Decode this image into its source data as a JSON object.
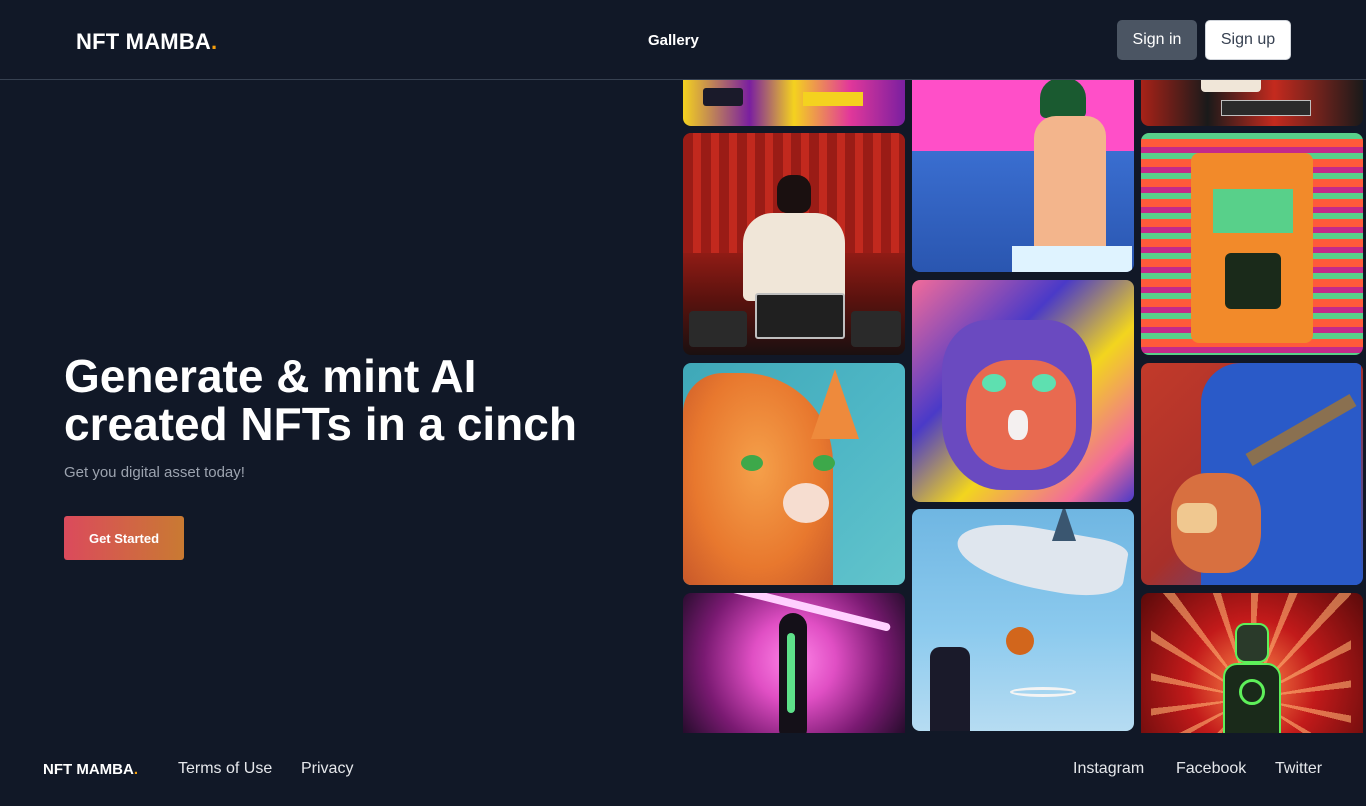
{
  "header": {
    "logo_text": "NFT MAMBA",
    "logo_dot": ".",
    "nav_gallery": "Gallery",
    "signin_label": "Sign in",
    "signup_label": "Sign up"
  },
  "hero": {
    "title": "Generate & mint AI created NFTs in a cinch",
    "subtitle": "Get you digital asset today!",
    "cta_label": "Get Started"
  },
  "gallery": {
    "tiles": [
      {
        "subject": "dj-turntables",
        "colors": [
          "#f4d21f",
          "#7a1fa0",
          "#e2389a"
        ]
      },
      {
        "subject": "dj-white-suit",
        "colors": [
          "#8c1a14",
          "#f0e6d8",
          "#1a1a1a"
        ]
      },
      {
        "subject": "orange-cat",
        "colors": [
          "#f08a3c",
          "#4fb7c6",
          "#f4c9a2"
        ]
      },
      {
        "subject": "neon-robot-woman",
        "colors": [
          "#e04fc4",
          "#1a0a22",
          "#5ee08a"
        ]
      },
      {
        "subject": "pixel-boy-sea",
        "colors": [
          "#ff4fc8",
          "#3466c8",
          "#f3b58c"
        ]
      },
      {
        "subject": "pixel-cat",
        "colors": [
          "#f26b9a",
          "#4a3ac8",
          "#f2d51e"
        ]
      },
      {
        "subject": "shark-basketball",
        "colors": [
          "#7fbfe6",
          "#dfe6ee",
          "#d2661c"
        ]
      },
      {
        "subject": "dj-turntables-2",
        "colors": [
          "#c42a1e",
          "#f0e6d8",
          "#1a1a1a"
        ]
      },
      {
        "subject": "pixel-robot-face",
        "colors": [
          "#ff5a3a",
          "#58d08a",
          "#c42a8a"
        ]
      },
      {
        "subject": "guitarist",
        "colors": [
          "#c23a2a",
          "#2a5ac8",
          "#f0c890"
        ]
      },
      {
        "subject": "neon-cyborg",
        "colors": [
          "#c21a1a",
          "#ff8a4a",
          "#5ef05a"
        ]
      }
    ]
  },
  "footer": {
    "logo_text": "NFT MAMBA",
    "logo_dot": ".",
    "terms": "Terms of Use",
    "privacy": "Privacy",
    "instagram": "Instagram",
    "facebook": "Facebook",
    "twitter": "Twitter"
  }
}
